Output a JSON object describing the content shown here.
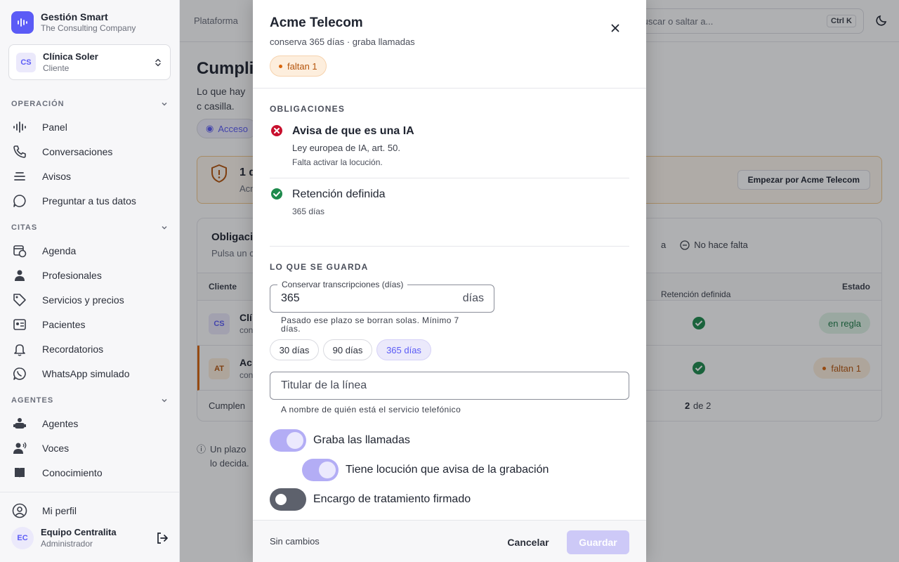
{
  "brand": {
    "title": "Gestión Smart",
    "subtitle": "The Consulting Company"
  },
  "client_switcher": {
    "initials": "CS",
    "name": "Clínica Soler",
    "role": "Cliente"
  },
  "sidebar": {
    "sections": [
      {
        "label": "OPERACIÓN",
        "items": [
          {
            "label": "Panel",
            "icon": "waveform-icon"
          },
          {
            "label": "Conversaciones",
            "icon": "phone-icon"
          },
          {
            "label": "Avisos",
            "icon": "list-icon"
          },
          {
            "label": "Preguntar a tus datos",
            "icon": "chat-icon"
          }
        ]
      },
      {
        "label": "CITAS",
        "items": [
          {
            "label": "Agenda",
            "icon": "calendar-clock-icon"
          },
          {
            "label": "Profesionales",
            "icon": "person-icon"
          },
          {
            "label": "Servicios y precios",
            "icon": "tag-icon"
          },
          {
            "label": "Pacientes",
            "icon": "id-card-icon"
          },
          {
            "label": "Recordatorios",
            "icon": "bell-icon"
          },
          {
            "label": "WhatsApp simulado",
            "icon": "whatsapp-icon"
          }
        ]
      },
      {
        "label": "AGENTES",
        "items": [
          {
            "label": "Agentes",
            "icon": "robot-icon"
          },
          {
            "label": "Voces",
            "icon": "voice-icon"
          },
          {
            "label": "Conocimiento",
            "icon": "book-icon"
          }
        ]
      }
    ],
    "profile_link": "Mi perfil",
    "user": {
      "initials": "EC",
      "name": "Equipo Centralita",
      "role": "Administrador"
    }
  },
  "topbar": {
    "breadcrumb": "Plataforma",
    "search_placeholder": "Buscar o saltar a...",
    "shortcut": "Ctrl K"
  },
  "page": {
    "title": "Cumpli",
    "description": "Lo que hay c casilla.",
    "access_chip": "Acceso",
    "alert": {
      "title": "1 d",
      "subtitle": "Acm",
      "button": "Empezar por Acme Telecom"
    },
    "card": {
      "title": "Obligaci",
      "subtitle": "Pulsa un c",
      "legend_partial": "a",
      "legend_na": "No hace falta",
      "columns": {
        "client": "Cliente",
        "retention": "Retención definida",
        "status": "Estado"
      },
      "rows": [
        {
          "initials": "CS",
          "name": "Clí",
          "sub": "con",
          "status": "en regla"
        },
        {
          "initials": "AT",
          "name": "Ac",
          "sub": "con",
          "status": "faltan 1"
        }
      ],
      "footer_label": "Cumplen",
      "footer_count": "2",
      "footer_of": "de 2"
    },
    "note": "Un plazo lo decida."
  },
  "modal": {
    "title": "Acme Telecom",
    "subtitle": "conserva 365 días · graba llamadas",
    "badge": "faltan 1",
    "obligations_label": "OBLIGACIONES",
    "obligations": [
      {
        "title": "Avisa de que es una IA",
        "sub": "Ley europea de IA, art. 50.",
        "hint": "Falta activar la locución.",
        "status": "error"
      },
      {
        "title": "Retención definida",
        "sub": "365 días",
        "status": "ok"
      }
    ],
    "storage_label": "LO QUE SE GUARDA",
    "retention_field": {
      "label": "Conservar transcripciones (días)",
      "value": "365",
      "unit": "días",
      "help": "Pasado ese plazo se borran solas. Mínimo 7 días."
    },
    "presets": [
      "30 días",
      "90 días",
      "365 días"
    ],
    "holder_field": {
      "placeholder": "Titular de la línea",
      "help": "A nombre de quién está el servicio telefónico"
    },
    "toggles": [
      {
        "label": "Graba las llamadas",
        "on": true
      },
      {
        "label": "Tiene locución que avisa de la grabación",
        "on": true
      },
      {
        "label": "Encargo de tratamiento firmado",
        "on": false
      }
    ],
    "footer": {
      "status": "Sin cambios",
      "cancel": "Cancelar",
      "save": "Guardar"
    }
  },
  "colors": {
    "accent": "#5b5bf6",
    "ok": "#1e8a4c",
    "error": "#c8102e",
    "warn": "#d9650b"
  }
}
